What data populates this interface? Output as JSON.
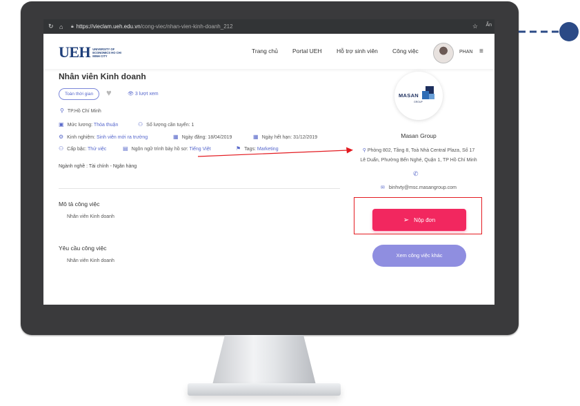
{
  "browser": {
    "url_host": "https://vieclam.ueh.edu.vn",
    "url_path": "/cong-viec/nhan-vien-kinh-doanh_212",
    "incognito_label": "Ẩn"
  },
  "header": {
    "logo_text": "UEH",
    "logo_subtext": "UNIVERSITY OF ECONOMICS HO CHI MINH CITY",
    "nav": [
      "Trang chủ",
      "Portal UEH",
      "Hỗ trợ sinh viên",
      "Công việc"
    ],
    "user_name": "PHAN"
  },
  "job": {
    "title": "Nhân viên Kinh doanh",
    "type_badge": "Toàn thời gian",
    "views": "3 lượt xem",
    "location": "TP.Hồ Chí Minh",
    "salary_label": "Mức lương:",
    "salary_value": "Thỏa thuận",
    "quantity": "Số lượng cần tuyển: 1",
    "experience_label": "Kinh nghiệm:",
    "experience_value": "Sinh viên mới ra trường",
    "posted": "Ngày đăng: 18/04/2019",
    "deadline": "Ngày hết hạn: 31/12/2019",
    "level_label": "Cấp bậc:",
    "level_value": "Thử việc",
    "language_label": "Ngôn ngữ trình bày hồ sơ:",
    "language_value": "Tiếng Việt",
    "tags_label": "Tags:",
    "tags_value": "Marketing",
    "industry": "Ngành nghề : Tài chính - Ngân hàng",
    "description_title": "Mô tả công việc",
    "description_body": "Nhân viên Kinh doanh",
    "requirements_title": "Yêu cầu công việc",
    "requirements_body": "Nhân viên Kinh doanh"
  },
  "company": {
    "logo_text": "MASAN",
    "logo_sub": "GROUP",
    "name": "Masan Group",
    "address_line1": "Phòng 802, Tầng 8, Toà Nhà Central Plaza, Số 17",
    "address_line2": "Lê Duẩn, Phường Bến Nghé, Quận 1, TP Hồ Chí Minh",
    "email": "binhvty@msc.masangroup.com",
    "apply_label": "Nộp đơn",
    "other_jobs_label": "Xem công việc khác"
  },
  "colors": {
    "accent": "#5566cc",
    "apply": "#f2275f",
    "other_jobs": "#8f8ee0",
    "annotation": "#e3191f",
    "bezel": "#3a3a3c",
    "callout": "#2b4a86"
  }
}
